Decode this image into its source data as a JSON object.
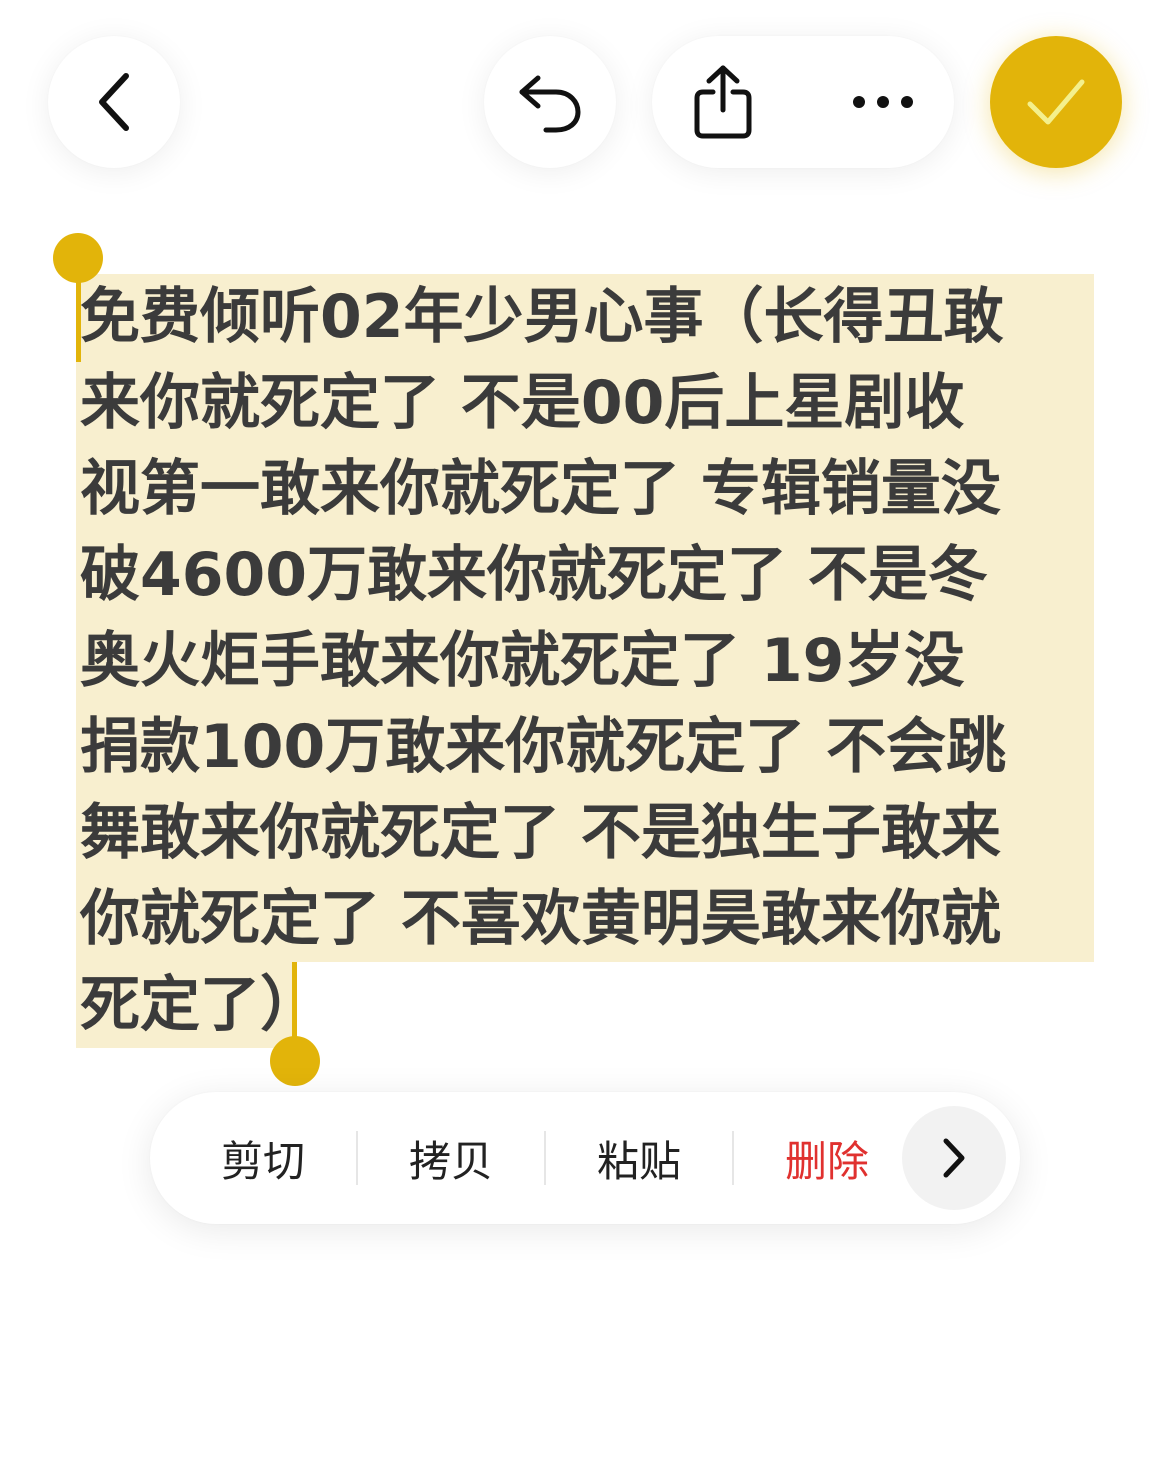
{
  "toolbar": {
    "back_icon": "chevron-left-icon",
    "undo_icon": "undo-icon",
    "share_icon": "share-icon",
    "more_icon": "more-icon",
    "done_icon": "checkmark-icon"
  },
  "note": {
    "lines": [
      "免费倾听02年少男心事（长得丑敢",
      "来你就死定了 不是00后上星剧收",
      "视第一敢来你就死定了 专辑销量没",
      "破4600万敢来你就死定了 不是冬",
      "奥火炬手敢来你就死定了 19岁没",
      "捐款100万敢来你就死定了 不会跳",
      "舞敢来你就死定了 不是独生子敢来",
      "你就死定了 不喜欢黄明昊敢来你就",
      "死定了）"
    ]
  },
  "context_menu": {
    "cut": "剪切",
    "copy": "拷贝",
    "paste": "粘贴",
    "delete": "删除",
    "next_icon": "chevron-right-icon"
  },
  "colors": {
    "accent": "#e2b40a",
    "selection": "#f8efcf",
    "danger": "#e0312f"
  }
}
